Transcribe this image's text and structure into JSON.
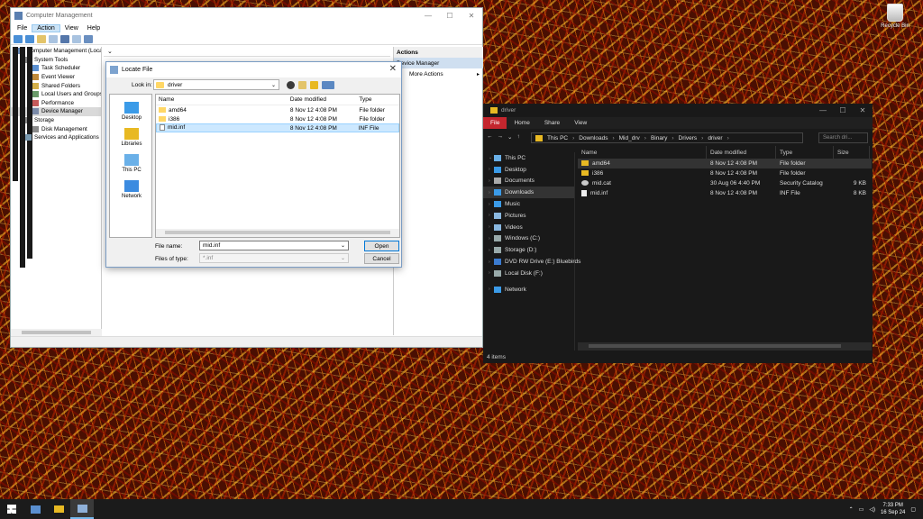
{
  "desktop": {
    "recycle_bin_label": "Recycle Bin"
  },
  "computer_management": {
    "title": "Computer Management",
    "menu": [
      "File",
      "Action",
      "View",
      "Help"
    ],
    "active_menu": "Action",
    "tree": [
      {
        "label": "Computer Management (Local",
        "depth": 0,
        "expander": ""
      },
      {
        "label": "System Tools",
        "depth": 1,
        "expander": "▾"
      },
      {
        "label": "Task Scheduler",
        "depth": 2,
        "expander": "›"
      },
      {
        "label": "Event Viewer",
        "depth": 2,
        "expander": "›"
      },
      {
        "label": "Shared Folders",
        "depth": 2,
        "expander": "›"
      },
      {
        "label": "Local Users and Groups",
        "depth": 2,
        "expander": "›"
      },
      {
        "label": "Performance",
        "depth": 2,
        "expander": "›"
      },
      {
        "label": "Device Manager",
        "depth": 2,
        "expander": "",
        "selected": true
      },
      {
        "label": "Storage",
        "depth": 1,
        "expander": "▾"
      },
      {
        "label": "Disk Management",
        "depth": 2,
        "expander": ""
      },
      {
        "label": "Services and Applications",
        "depth": 1,
        "expander": "›"
      }
    ],
    "actions": {
      "header": "Actions",
      "subheader": "Device Manager",
      "items": [
        "More Actions"
      ]
    }
  },
  "locate_file": {
    "title": "Locate File",
    "look_in_label": "Look in:",
    "look_in_value": "driver",
    "places": [
      "Desktop",
      "Libraries",
      "This PC",
      "Network"
    ],
    "columns": [
      "Name",
      "Date modified",
      "Type"
    ],
    "rows": [
      {
        "name": "amd64",
        "date": "8 Nov 12 4:08 PM",
        "type": "File folder",
        "kind": "folder"
      },
      {
        "name": "i386",
        "date": "8 Nov 12 4:08 PM",
        "type": "File folder",
        "kind": "folder"
      },
      {
        "name": "mid.inf",
        "date": "8 Nov 12 4:08 PM",
        "type": "INF File",
        "kind": "doc",
        "selected": true
      }
    ],
    "file_name_label": "File name:",
    "file_name_value": "mid.inf",
    "files_of_type_label": "Files of type:",
    "files_of_type_value": "*.inf",
    "open_button": "Open",
    "cancel_button": "Cancel"
  },
  "explorer": {
    "title": "driver",
    "ribbon_tabs": [
      "File",
      "Home",
      "Share",
      "View"
    ],
    "breadcrumb": [
      "This PC",
      "Downloads",
      "Mid_drv",
      "Binary",
      "Drivers",
      "driver"
    ],
    "search_placeholder": "Search dri...",
    "nav": [
      {
        "label": "This PC",
        "icon": "pc",
        "chev": "⌄"
      },
      {
        "label": "Desktop",
        "icon": "desktop",
        "chev": "›"
      },
      {
        "label": "Documents",
        "icon": "documents",
        "chev": "›"
      },
      {
        "label": "Downloads",
        "icon": "downloads",
        "chev": "›",
        "selected": true
      },
      {
        "label": "Music",
        "icon": "music",
        "chev": "›"
      },
      {
        "label": "Pictures",
        "icon": "pictures",
        "chev": "›"
      },
      {
        "label": "Videos",
        "icon": "videos",
        "chev": "›"
      },
      {
        "label": "Windows (C:)",
        "icon": "drive",
        "chev": "›"
      },
      {
        "label": "Storage (D:)",
        "icon": "drive",
        "chev": "›"
      },
      {
        "label": "DVD RW Drive (E:) Bluebirds",
        "icon": "dvd",
        "chev": "›"
      },
      {
        "label": "Local Disk (F:)",
        "icon": "drive",
        "chev": "›"
      },
      {
        "label": "Network",
        "icon": "network",
        "chev": "›"
      }
    ],
    "columns": [
      "Name",
      "Date modified",
      "Type",
      "Size"
    ],
    "rows": [
      {
        "name": "amd64",
        "date": "8 Nov 12 4:08 PM",
        "type": "File folder",
        "size": "",
        "kind": "folder",
        "hover": true
      },
      {
        "name": "i386",
        "date": "8 Nov 12 4:08 PM",
        "type": "File folder",
        "size": "",
        "kind": "folder"
      },
      {
        "name": "mid.cat",
        "date": "30 Aug 06 4:40 PM",
        "type": "Security Catalog",
        "size": "9 KB",
        "kind": "cat"
      },
      {
        "name": "mid.inf",
        "date": "8 Nov 12 4:08 PM",
        "type": "INF File",
        "size": "8 KB",
        "kind": "doc"
      }
    ],
    "status": "4 items"
  },
  "taskbar": {
    "time": "7:33 PM",
    "date": "16 Sep 24"
  },
  "colors": {
    "accent": "#0078d7",
    "file_tab": "#c4262e",
    "folder": "#e8b923"
  }
}
